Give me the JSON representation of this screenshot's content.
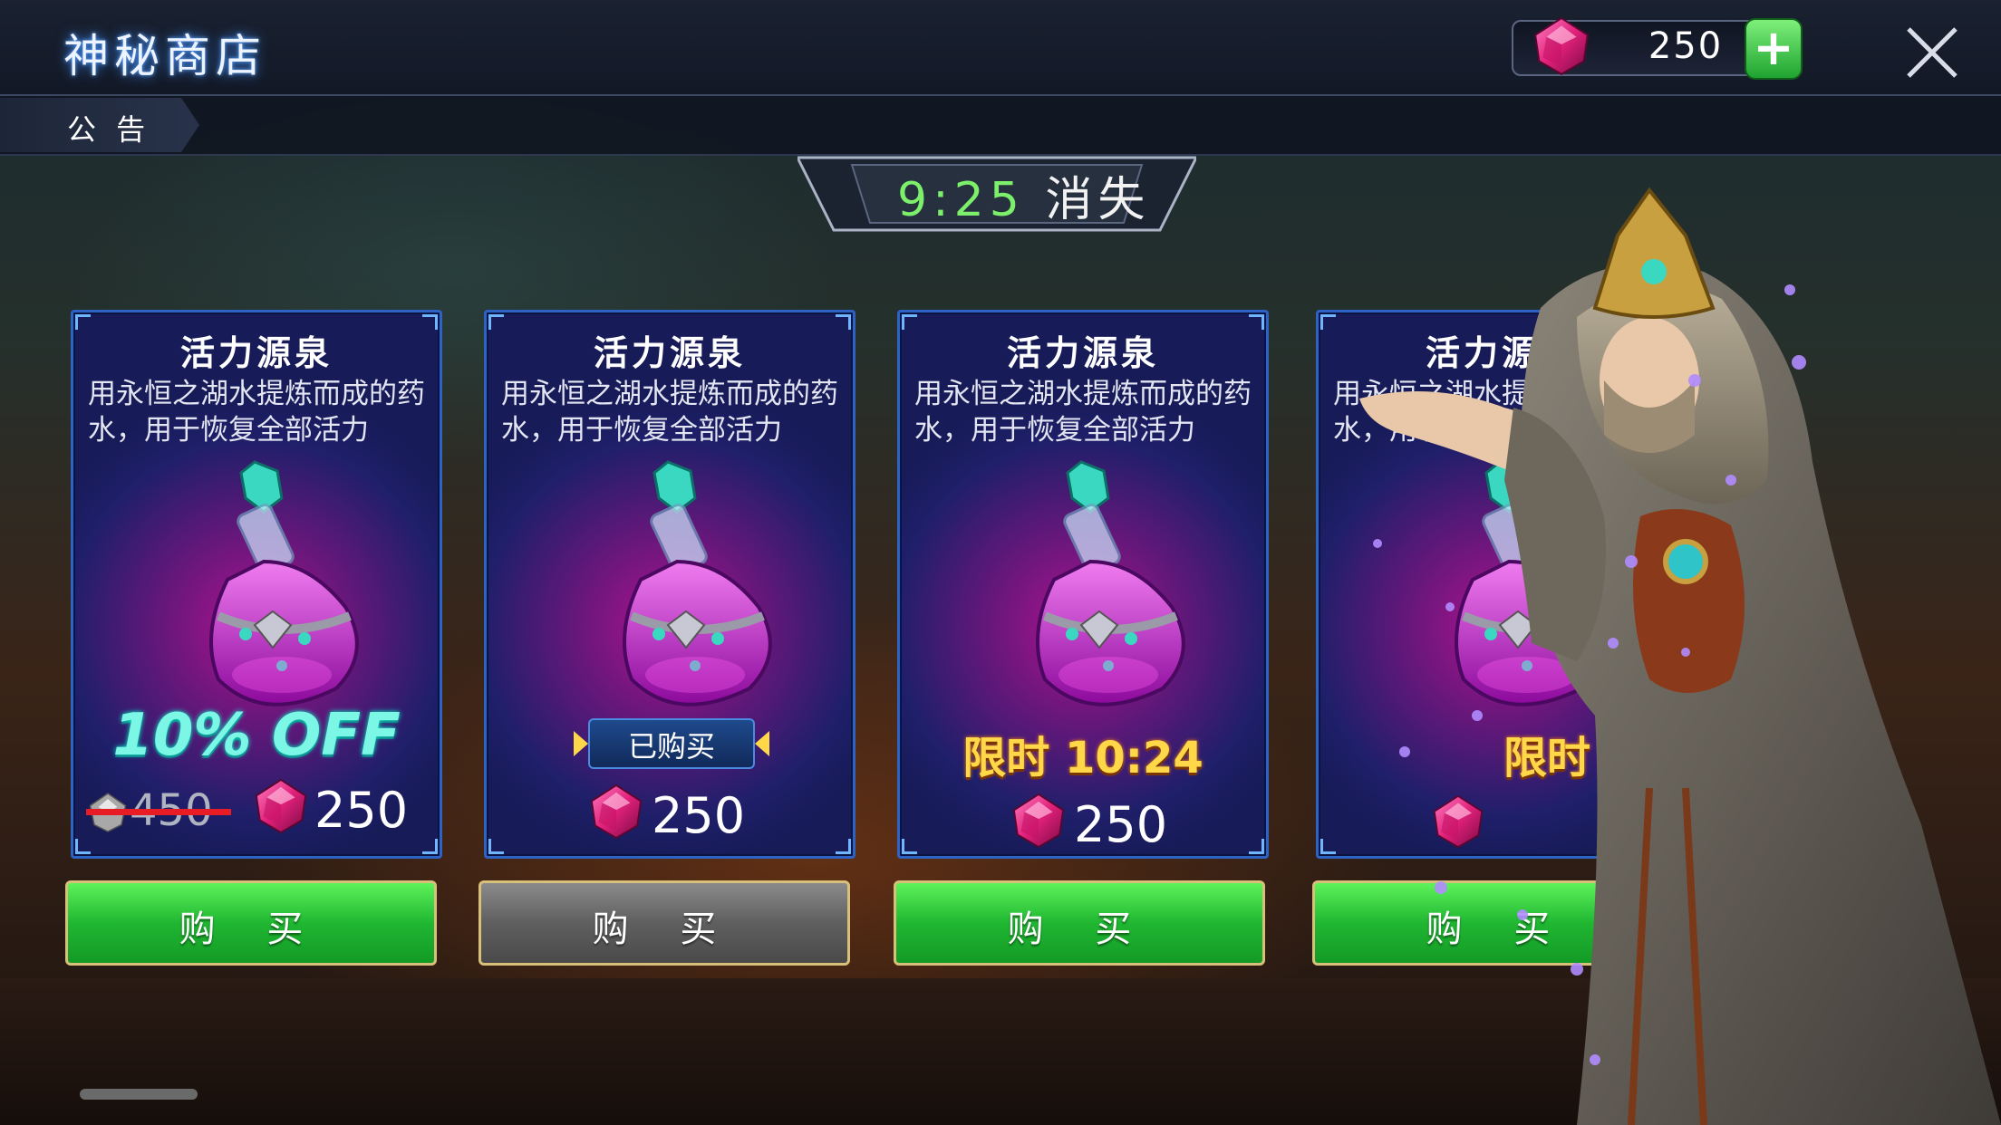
{
  "header": {
    "title": "神秘商店",
    "tab_label": "公 告",
    "currency_value": "250",
    "currency_icon": "gem-icon",
    "add_icon": "plus-icon",
    "close_icon": "close-icon"
  },
  "timer": {
    "time": "9:25",
    "label": "消失"
  },
  "colors": {
    "accent_green": "#20b732",
    "gem": "#e0207a",
    "discount": "#7cf7e6",
    "limited": "#ffd84a"
  },
  "cards": [
    {
      "name": "活力源泉",
      "description": "用永恒之湖水提炼而成的药水，用于恢复全部活力",
      "discount": "10% OFF",
      "old_price": "450",
      "price": "250",
      "buy_label": "购 买",
      "state": "available"
    },
    {
      "name": "活力源泉",
      "description": "用永恒之湖水提炼而成的药水，用于恢复全部活力",
      "purchased_label": "已购买",
      "price": "250",
      "buy_label": "购 买",
      "state": "purchased"
    },
    {
      "name": "活力源泉",
      "description": "用永恒之湖水提炼而成的药水，用于恢复全部活力",
      "limited_label": "限时 10:24",
      "price": "250",
      "buy_label": "购 买",
      "state": "available"
    },
    {
      "name": "活力源泉",
      "description": "用永恒之湖水提炼而成的药水，用于恢复全部活力",
      "limited_label": "限时",
      "price": "",
      "buy_label": "购 买",
      "state": "available"
    }
  ]
}
